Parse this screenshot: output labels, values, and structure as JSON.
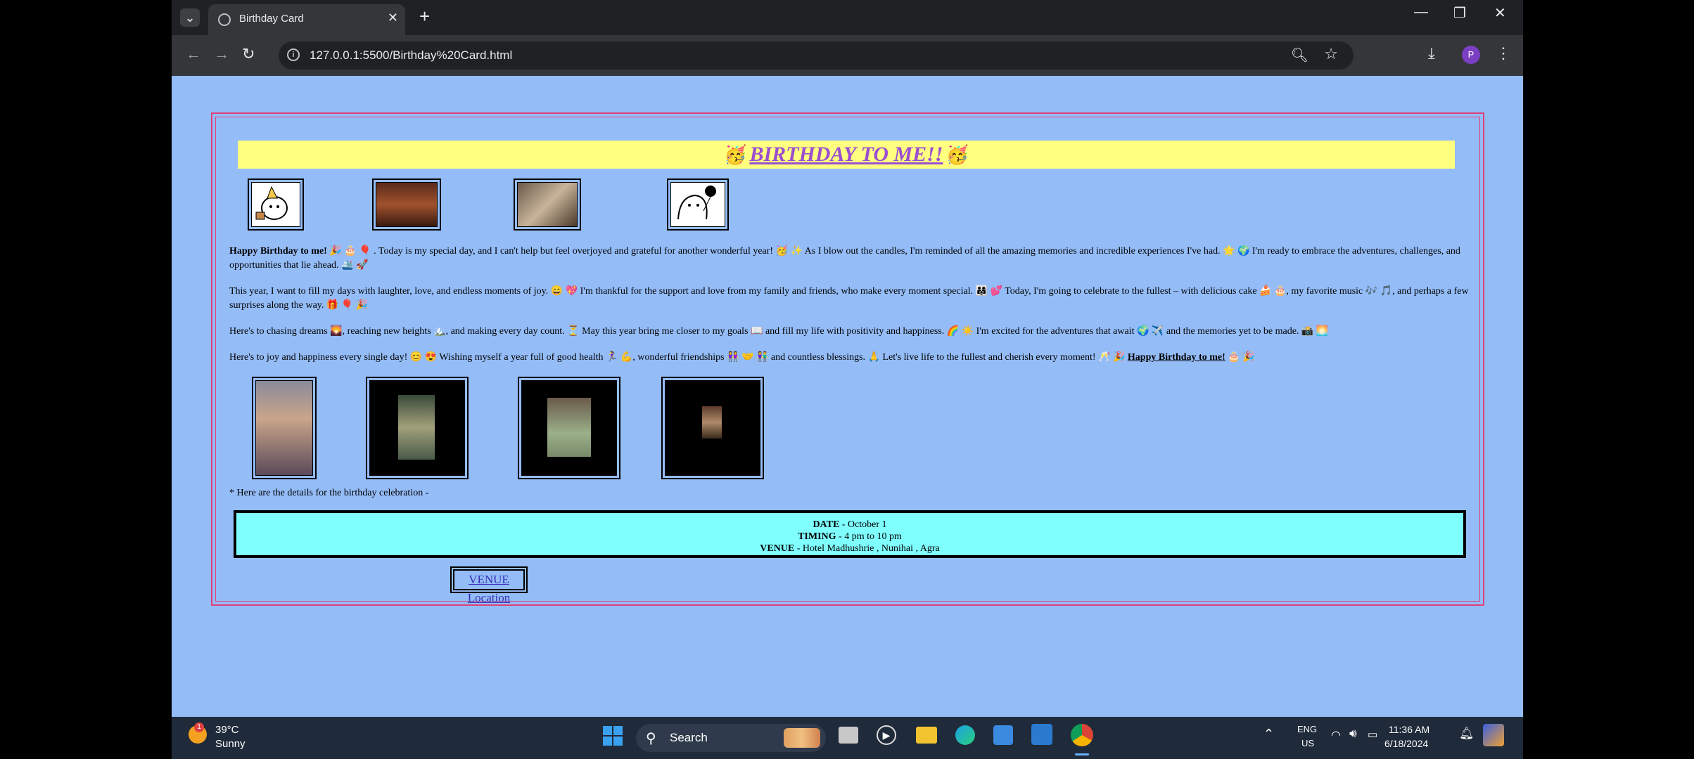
{
  "browser": {
    "tab_title": "Birthday Card",
    "url": "127.0.0.1:5500/Birthday%20Card.html",
    "profile_initial": "P"
  },
  "card": {
    "heading": "BIRTHDAY TO ME!!",
    "heading_emoji": "🥳",
    "para1_bold": "Happy Birthday to me!",
    "para1_text": " 🎉 🎂 🎈 . Today is my special day, and I can't help but feel overjoyed and grateful for another wonderful year! 🥳 ✨ As I blow out the candles, I'm reminded of all the amazing memories and incredible experiences I've had. 🌟 🌍 I'm ready to embrace the adventures, challenges, and opportunities that lie ahead. 🛳️ 🚀",
    "para2": "This year, I want to fill my days with laughter, love, and endless moments of joy. 😄 💖 I'm thankful for the support and love from my family and friends, who make every moment special. 👨‍👩‍👧 💕 Today, I'm going to celebrate to the fullest – with delicious cake 🍰 🎂, my favorite music 🎶 🎵, and perhaps a few surprises along the way. 🎁 🎈 🎉",
    "para3": "Here's to chasing dreams 🌄, reaching new heights 🏔️, and making every day count. ⏳ May this year bring me closer to my goals 📖 and fill my life with positivity and happiness. 🌈 ☀️ I'm excited for the adventures that await 🌍 ✈️ and the memories yet to be made. 📸 🌅",
    "para4_text": "Here's to joy and happiness every single day! 😊 😍 Wishing myself a year full of good health 🏃‍♀️ 💪, wonderful friendships 👭 🤝 👫 and countless blessings. 🙏 Let's live life to the fullest and cherish every moment! 🥂 🎉 ",
    "para4_bold": "Happy Birthday to me!",
    "para4_end": " 🎂 🎉",
    "details_intro": "* Here are the details for the birthday celebration -",
    "date_label": "DATE",
    "date_value": " - October 1",
    "timing_label": "TIMING",
    "timing_value": " - 4 pm to 10 pm",
    "venue_label": "VENUE",
    "venue_value": " - Hotel Madhushrie , Nunihai , Agra",
    "venue_link": "VENUE Location"
  },
  "taskbar": {
    "temp": "39°C",
    "weather": "Sunny",
    "search": "Search",
    "lang1": "ENG",
    "lang2": "US",
    "time": "11:36 AM",
    "date": "6/18/2024",
    "weather_badge": "1"
  }
}
